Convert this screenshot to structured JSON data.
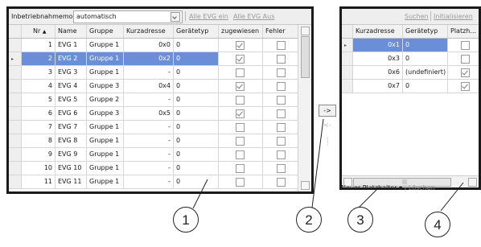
{
  "left": {
    "mode_label": "Inbetriebnahmemodus",
    "mode_value": "automatisch",
    "link_all_on": "Alle EVG ein",
    "link_all_off": "Alle EVG Aus",
    "columns": [
      "Nr",
      "Name",
      "Gruppe",
      "Kurzadresse",
      "Gerätetyp",
      "zugewiesen",
      "Fehler"
    ],
    "rows": [
      {
        "nr": "1",
        "name": "EVG 1",
        "gruppe": "Gruppe 1",
        "kurz": "0x0",
        "typ": "0",
        "zugewiesen": true,
        "fehler": false
      },
      {
        "nr": "2",
        "name": "EVG 2",
        "gruppe": "Gruppe 1",
        "kurz": "0x2",
        "typ": "0",
        "zugewiesen": true,
        "fehler": false
      },
      {
        "nr": "3",
        "name": "EVG 3",
        "gruppe": "Gruppe 1",
        "kurz": "-",
        "typ": "0",
        "zugewiesen": false,
        "fehler": false
      },
      {
        "nr": "4",
        "name": "EVG 4",
        "gruppe": "Gruppe 3",
        "kurz": "0x4",
        "typ": "0",
        "zugewiesen": true,
        "fehler": false
      },
      {
        "nr": "5",
        "name": "EVG 5",
        "gruppe": "Gruppe 2",
        "kurz": "-",
        "typ": "0",
        "zugewiesen": false,
        "fehler": false
      },
      {
        "nr": "6",
        "name": "EVG 6",
        "gruppe": "Gruppe 3",
        "kurz": "0x5",
        "typ": "0",
        "zugewiesen": true,
        "fehler": false
      },
      {
        "nr": "7",
        "name": "EVG 7",
        "gruppe": "Gruppe 1",
        "kurz": "-",
        "typ": "0",
        "zugewiesen": false,
        "fehler": false
      },
      {
        "nr": "8",
        "name": "EVG 8",
        "gruppe": "Gruppe 1",
        "kurz": "-",
        "typ": "0",
        "zugewiesen": false,
        "fehler": false
      },
      {
        "nr": "9",
        "name": "EVG 9",
        "gruppe": "Gruppe 1",
        "kurz": "-",
        "typ": "0",
        "zugewiesen": false,
        "fehler": false
      },
      {
        "nr": "10",
        "name": "EVG 10",
        "gruppe": "Gruppe 1",
        "kurz": "-",
        "typ": "0",
        "zugewiesen": false,
        "fehler": false
      },
      {
        "nr": "11",
        "name": "EVG 11",
        "gruppe": "Gruppe 1",
        "kurz": "-",
        "typ": "0",
        "zugewiesen": false,
        "fehler": false
      }
    ],
    "selected_row": 1
  },
  "middle": {
    "move_right": "->",
    "move_left": "<-"
  },
  "right": {
    "link_search": "Suchen",
    "link_init": "Initialisieren",
    "columns": [
      "Kurzadresse",
      "Gerätetyp",
      "Platzh..."
    ],
    "rows": [
      {
        "kurz": "0x1",
        "typ": "0",
        "platz": false
      },
      {
        "kurz": "0x3",
        "typ": "0",
        "platz": false
      },
      {
        "kurz": "0x6",
        "typ": "(undefiniert)",
        "platz": true
      },
      {
        "kurz": "0x7",
        "typ": "0",
        "platz": true
      }
    ],
    "selected_row": 0,
    "new_placeholder": "Neuer Platzhalter ▾",
    "delete": "Löschen"
  },
  "callouts": [
    "1",
    "2",
    "3",
    "4"
  ],
  "colors": {
    "selection": "#6a8fd8",
    "border": "#1b1b1b"
  }
}
